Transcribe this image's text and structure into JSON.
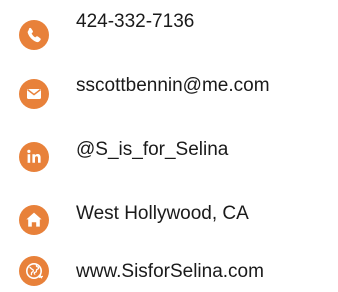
{
  "accent_color": "#E8813A",
  "contacts": [
    {
      "icon": "phone-icon",
      "text": "424-332-7136"
    },
    {
      "icon": "mail-icon",
      "text": "sscottbennin@me.com"
    },
    {
      "icon": "linkedin-icon",
      "text": "@S_is_for_Selina"
    },
    {
      "icon": "home-icon",
      "text": "West Hollywood, CA"
    },
    {
      "icon": "globe-icon",
      "text": "www.SisforSelina.com"
    }
  ]
}
